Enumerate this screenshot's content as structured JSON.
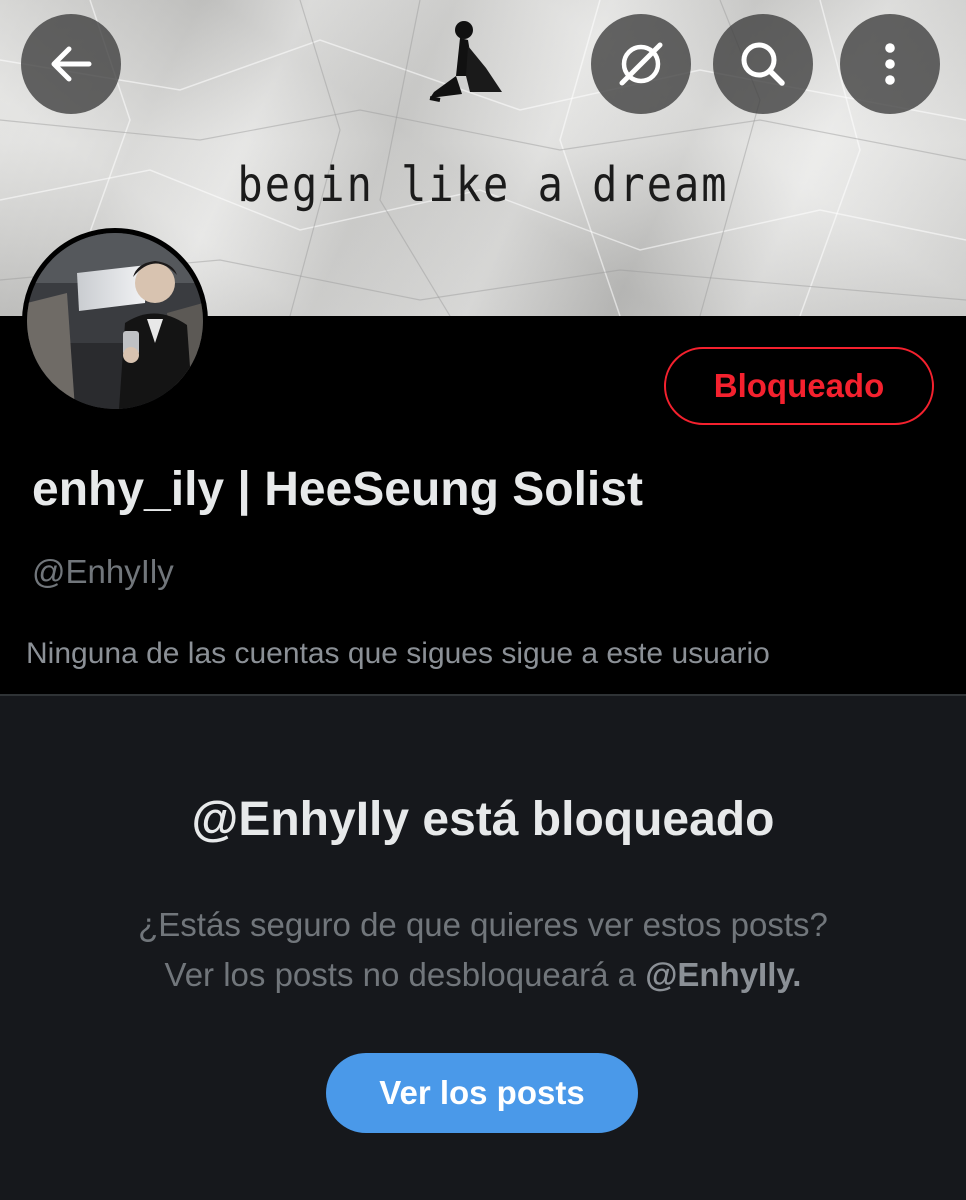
{
  "banner": {
    "text": "begin like a dream"
  },
  "toolbar": {
    "back_icon": "arrow-left-icon",
    "grok_icon": "grok-icon",
    "search_icon": "search-icon",
    "more_icon": "more-vertical-icon"
  },
  "profile": {
    "display_name": "enhy_ily | HeeSeung Solist",
    "handle": "@EnhyIly",
    "followers_note": "Ninguna de las cuentas que sigues sigue a este usuario",
    "blocked_label": "Bloqueado"
  },
  "blocked_panel": {
    "title": "@EnhyIly está bloqueado",
    "message_line1": "¿Estás seguro de que quieres ver estos posts?",
    "message_line2_prefix": "Ver los posts no desbloqueará a",
    "message_line2_handle": "@EnhyIly.",
    "view_button": "Ver los posts"
  },
  "colors": {
    "blocked_red": "#f4212e",
    "accent_blue": "#4a99e9",
    "panel_bg": "#16181c"
  }
}
